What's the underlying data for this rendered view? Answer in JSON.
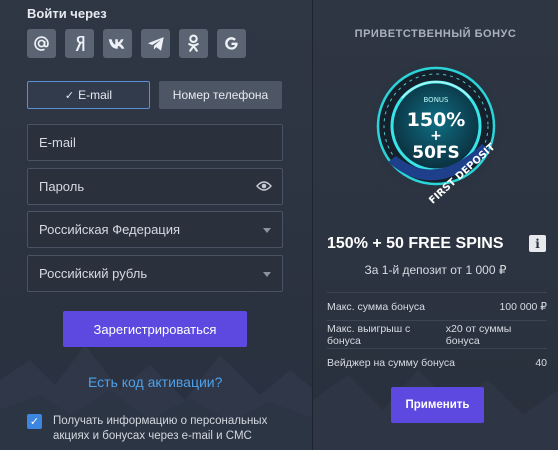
{
  "login": {
    "title": "Войти через",
    "social_icons": [
      "at-sign-icon",
      "yandex-icon",
      "vk-icon",
      "telegram-icon",
      "odnoklassniki-icon",
      "google-icon"
    ]
  },
  "tabs": [
    {
      "label": "E-mail",
      "active": true
    },
    {
      "label": "Номер телефона",
      "active": false
    }
  ],
  "form": {
    "email_placeholder": "E-mail",
    "password_placeholder": "Пароль",
    "country_value": "Российская Федерация",
    "currency_value": "Российский рубль",
    "register_label": "Зарегистрироваться",
    "activation_link": "Есть код активации?",
    "consent_checked": true,
    "consent_text": "Получать информацию о персональных акциях и бонусах через e-mail и СМС"
  },
  "bonus": {
    "header": "ПРИВЕТСТВЕННЫЙ БОНУС",
    "badge_small": "BONUS",
    "badge_percent": "150%",
    "badge_plus": "+",
    "badge_fs": "50FS",
    "badge_ribbon": "FIRST DEPOSIT",
    "title": "150% + 50 FREE SPINS",
    "info_label": "i",
    "subtitle": "За 1-й депозит от 1 000 ₽",
    "rows": [
      {
        "label": "Макс. сумма бонуса",
        "value": "100 000 ₽"
      },
      {
        "label": "Макс. выигрыш с бонуса",
        "value": "x20 от суммы бонуса"
      },
      {
        "label": "Вейджер на сумму бонуса",
        "value": "40"
      }
    ],
    "apply_label": "Применить"
  },
  "colors": {
    "accent": "#5d49e0",
    "link": "#4fa0e8",
    "badge_glow": "#2ad4d8"
  }
}
